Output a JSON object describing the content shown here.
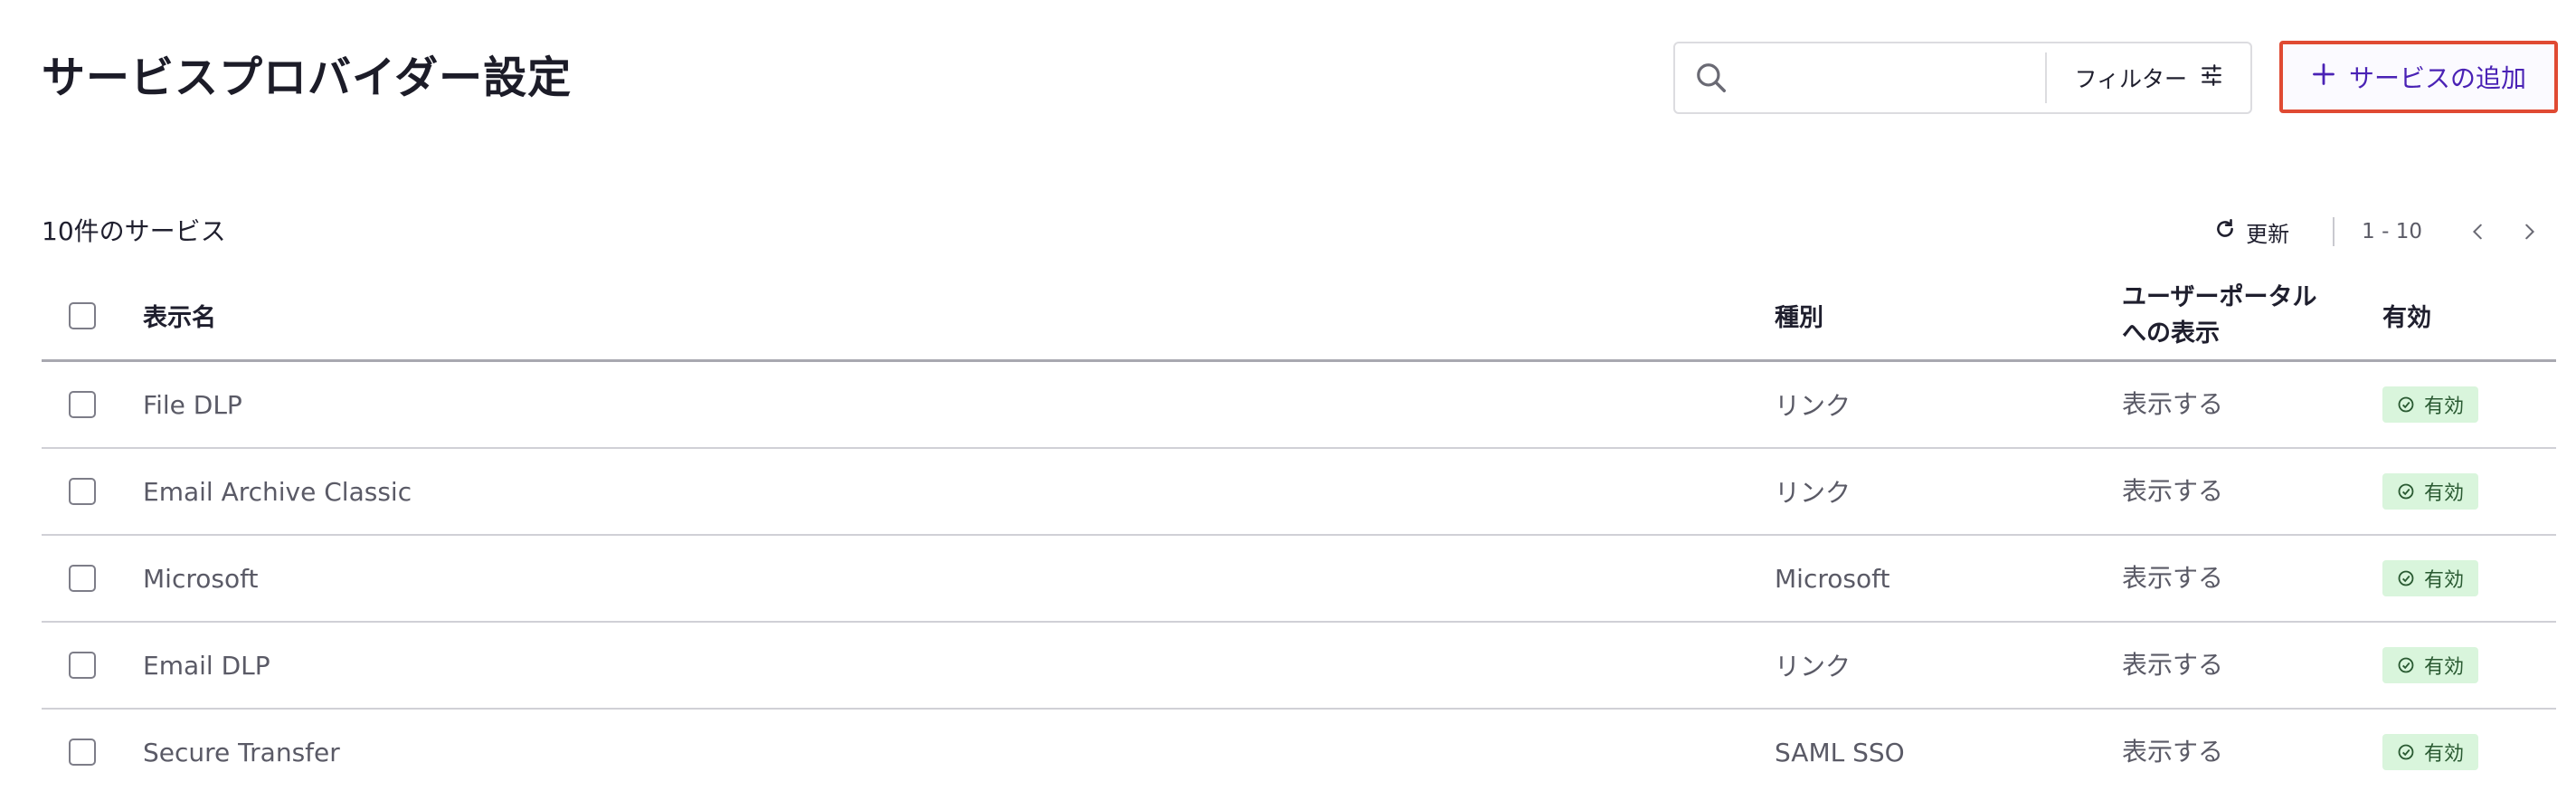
{
  "page": {
    "title": "サービスプロバイダー設定"
  },
  "search": {
    "placeholder": ""
  },
  "filter": {
    "label": "フィルター"
  },
  "add_service": {
    "label": "サービスの追加"
  },
  "summary": {
    "count_text": "10件のサービス"
  },
  "toolbar": {
    "refresh_label": "更新",
    "range": "1 - 10"
  },
  "table": {
    "headers": {
      "name": "表示名",
      "type": "種別",
      "portal": "ユーザーポータル\nへの表示",
      "enabled": "有効"
    },
    "rows": [
      {
        "name": "File DLP",
        "type": "リンク",
        "portal": "表示する",
        "enabled": "有効"
      },
      {
        "name": "Email Archive Classic",
        "type": "リンク",
        "portal": "表示する",
        "enabled": "有効"
      },
      {
        "name": "Microsoft",
        "type": "Microsoft",
        "portal": "表示する",
        "enabled": "有効"
      },
      {
        "name": "Email DLP",
        "type": "リンク",
        "portal": "表示する",
        "enabled": "有効"
      },
      {
        "name": "Secure Transfer",
        "type": "SAML SSO",
        "portal": "表示する",
        "enabled": "有効"
      }
    ]
  },
  "colors": {
    "accent": "#4a22b5",
    "focus_outline": "#e04a33",
    "badge_bg": "#d9f5dc",
    "badge_text": "#2a5a32"
  },
  "icons": {
    "search": "search-icon",
    "filter": "sliders-icon",
    "add": "plus-icon",
    "refresh": "refresh-icon",
    "prev": "chevron-left-icon",
    "next": "chevron-right-icon",
    "enabled": "check-circle-icon"
  }
}
